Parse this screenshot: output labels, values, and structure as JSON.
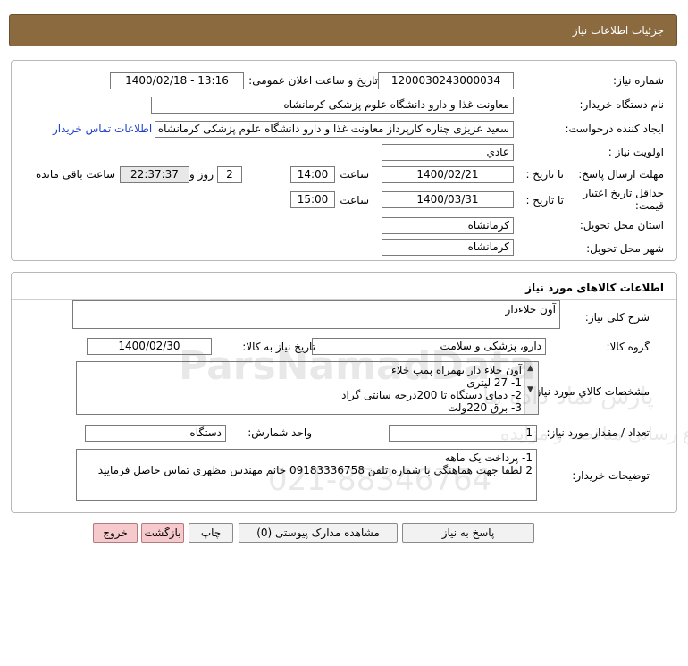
{
  "header": {
    "title": "جزئیات اطلاعات نیاز"
  },
  "info": {
    "need_number_label": "شماره نیاز:",
    "need_number": "1200030243000034",
    "announce_label": "تاریخ و ساعت اعلان عمومی:",
    "announce_value": "1400/02/18 - 13:16",
    "buyer_org_label": "نام دستگاه خریدار:",
    "buyer_org": "معاونت غذا و دارو دانشگاه علوم پزشکی کرمانشاه",
    "requester_label": "ایجاد کننده درخواست:",
    "requester": "سعید عزیزی چناره کارپرداز معاونت غذا و دارو دانشگاه علوم پزشکی کرمانشاه",
    "contact_link": "اطلاعات تماس خریدار",
    "priority_label": "اولویت نیاز :",
    "priority": "عادي",
    "deadline_label": "مهلت ارسال پاسخ:",
    "to_date_label": "تا تاریخ :",
    "deadline_date": "1400/02/21",
    "time_label": "ساعت",
    "deadline_time": "14:00",
    "days": "2",
    "days_label": "روز و",
    "remaining_time": "22:37:37",
    "remaining_label": "ساعت باقی مانده",
    "price_valid_label": "حداقل تاریخ اعتبار قیمت:",
    "price_to_date_label": "تا تاریخ :",
    "price_valid_date": "1400/03/31",
    "price_time_label": "ساعت",
    "price_valid_time": "15:00",
    "province_label": "استان محل تحویل:",
    "province": "کرمانشاه",
    "city_label": "شهر محل تحویل:",
    "city": "کرمانشاه"
  },
  "goods": {
    "title": "اطلاعات کالاهای مورد نیاز",
    "summary_label": "شرح کلی نیاز:",
    "summary": "آون خلاءدار",
    "group_label": "گروه کالا:",
    "group": "دارو، پزشکی و سلامت",
    "need_date_label": "تاریخ نیاز به کالا:",
    "need_date": "1400/02/30",
    "specs_label": "مشخصات کالاي مورد نياز:",
    "specs": [
      "آون خلاء دار بهمراه پمپ خلاء",
      "1- 27 لیتری",
      "2- دمای دستگاه تا 200درجه سانتی گراد",
      "3- برق 220ولت"
    ],
    "qty_label": "تعداد / مقدار مورد نیاز:",
    "qty": "1",
    "unit_label": "واحد شمارش:",
    "unit": "دستگاه",
    "buyer_notes_label": "توضیحات خریدار:",
    "buyer_notes": [
      "1- پرداخت یک ماهه",
      "2 لطفا جهت هماهنگی با شماره تلفن 09183336758 خانم مهندس مظهری تماس حاصل فرمایید"
    ]
  },
  "buttons": {
    "reply": "پاسخ به نیاز",
    "attachments": "مشاهده مدارک پیوستی (0)",
    "print": "چاپ",
    "back": "بازگشت",
    "exit": "خروج"
  },
  "watermark": {
    "latin": "ParsNamadData",
    "persian_1": "پارس نماد داده ها",
    "persian_2": "پایگاه اطلاع رسانی مناقصه و مزایده",
    "phone": "021-88346764"
  }
}
